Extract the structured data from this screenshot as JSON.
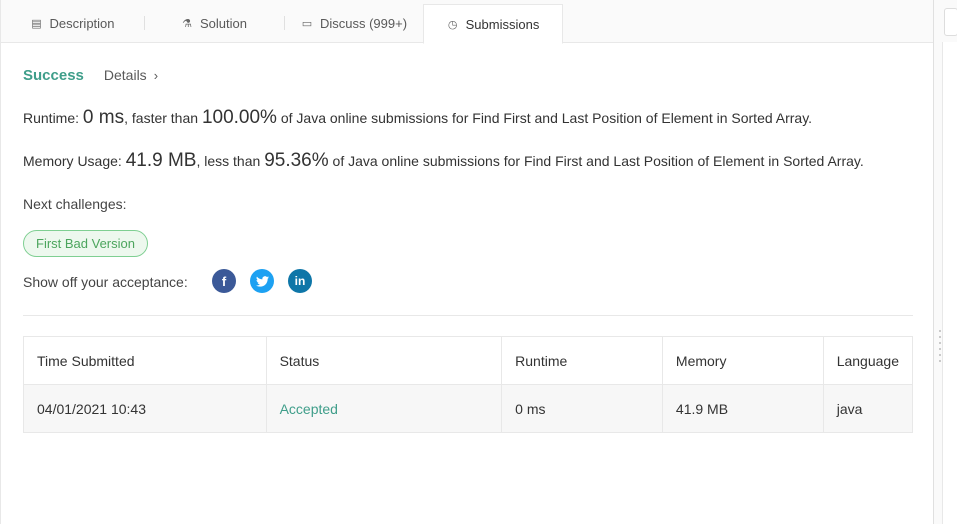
{
  "tabs": [
    {
      "label": "Description",
      "icon": "description-icon"
    },
    {
      "label": "Solution",
      "icon": "flask-icon"
    },
    {
      "label": "Discuss (999+)",
      "icon": "discuss-icon"
    },
    {
      "label": "Submissions",
      "icon": "clock-icon"
    }
  ],
  "active_tab": "Submissions",
  "result": {
    "status": "Success",
    "details_label": "Details",
    "details_chevron": "›"
  },
  "runtime": {
    "label": "Runtime:",
    "value": "0 ms",
    "middle": ", faster than",
    "percent": "100.00%",
    "suffix": "of Java online submissions for Find First and Last Position of Element in Sorted Array."
  },
  "memory": {
    "label": "Memory Usage:",
    "value": "41.9 MB",
    "middle": ", less than",
    "percent": "95.36%",
    "suffix": "of Java online submissions for Find First and Last Position of Element in Sorted Array."
  },
  "next_challenges": {
    "label": "Next challenges:",
    "items": [
      "First Bad Version"
    ]
  },
  "share": {
    "label": "Show off your acceptance:",
    "facebook": "f",
    "twitter": "🐦",
    "linkedin": "in"
  },
  "table": {
    "headers": [
      "Time Submitted",
      "Status",
      "Runtime",
      "Memory",
      "Language"
    ],
    "rows": [
      {
        "time": "04/01/2021 10:43",
        "status": "Accepted",
        "runtime": "0 ms",
        "memory": "41.9 MB",
        "language": "java"
      }
    ]
  },
  "colors": {
    "success": "#3f9e8a",
    "challenge_border": "#7fcf92",
    "facebook": "#3b5998",
    "twitter": "#1da1f2",
    "linkedin": "#0e76a8"
  }
}
